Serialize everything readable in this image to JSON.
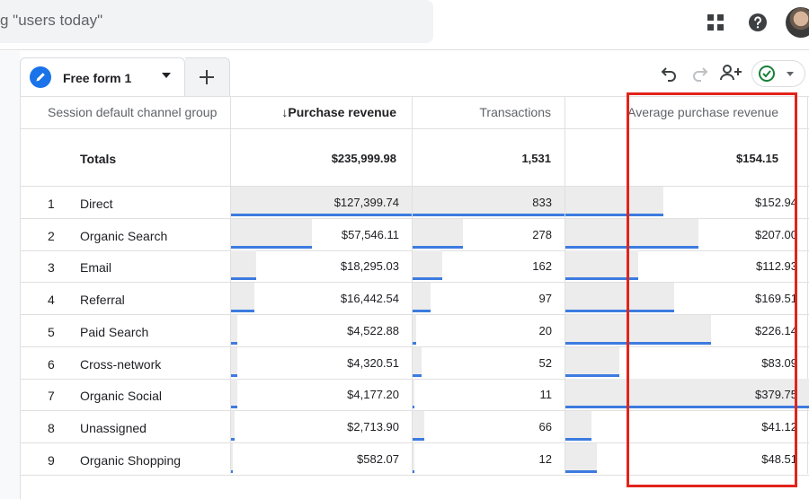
{
  "search": {
    "placeholder_text": "g \"users today\""
  },
  "header_icons": [
    "apps-icon",
    "help-icon"
  ],
  "tab": {
    "label": "Free form 1"
  },
  "columns": {
    "dimension": "Session default channel group",
    "col1": "Purchase revenue",
    "col1_sort": "↓",
    "col2": "Transactions",
    "col3": "Average purchase revenue"
  },
  "totals": {
    "label": "Totals",
    "purchase_revenue": "$235,999.98",
    "transactions": "1,531",
    "avg_purchase_revenue": "$154.15"
  },
  "rows": [
    {
      "num": "1",
      "name": "Direct",
      "revenue": "$127,399.74",
      "rev_frac": 1.0,
      "transactions": "833",
      "tx_frac": 1.0,
      "avg": "$152.94",
      "avg_frac": 0.4
    },
    {
      "num": "2",
      "name": "Organic Search",
      "revenue": "$57,546.11",
      "rev_frac": 0.45,
      "transactions": "278",
      "tx_frac": 0.33,
      "avg": "$207.00",
      "avg_frac": 0.545
    },
    {
      "num": "3",
      "name": "Email",
      "revenue": "$18,295.03",
      "rev_frac": 0.14,
      "transactions": "162",
      "tx_frac": 0.195,
      "avg": "$112.93",
      "avg_frac": 0.297
    },
    {
      "num": "4",
      "name": "Referral",
      "revenue": "$16,442.54",
      "rev_frac": 0.13,
      "transactions": "97",
      "tx_frac": 0.117,
      "avg": "$169.51",
      "avg_frac": 0.446
    },
    {
      "num": "5",
      "name": "Paid Search",
      "revenue": "$4,522.88",
      "rev_frac": 0.035,
      "transactions": "20",
      "tx_frac": 0.024,
      "avg": "$226.14",
      "avg_frac": 0.595
    },
    {
      "num": "6",
      "name": "Cross-network",
      "revenue": "$4,320.51",
      "rev_frac": 0.034,
      "transactions": "52",
      "tx_frac": 0.062,
      "avg": "$83.09",
      "avg_frac": 0.219
    },
    {
      "num": "7",
      "name": "Organic Social",
      "revenue": "$4,177.20",
      "rev_frac": 0.033,
      "transactions": "11",
      "tx_frac": 0.013,
      "avg": "$379.75",
      "avg_frac": 1.0
    },
    {
      "num": "8",
      "name": "Unassigned",
      "revenue": "$2,713.90",
      "rev_frac": 0.021,
      "transactions": "66",
      "tx_frac": 0.079,
      "avg": "$41.12",
      "avg_frac": 0.108
    },
    {
      "num": "9",
      "name": "Organic Shopping",
      "revenue": "$582.07",
      "rev_frac": 0.005,
      "transactions": "12",
      "tx_frac": 0.014,
      "avg": "$48.51",
      "avg_frac": 0.128
    }
  ],
  "colors": {
    "bar_fill": "#ececec",
    "bar_line": "#3c7be0",
    "highlight": "#e2231a",
    "accent": "#1a73e8"
  }
}
